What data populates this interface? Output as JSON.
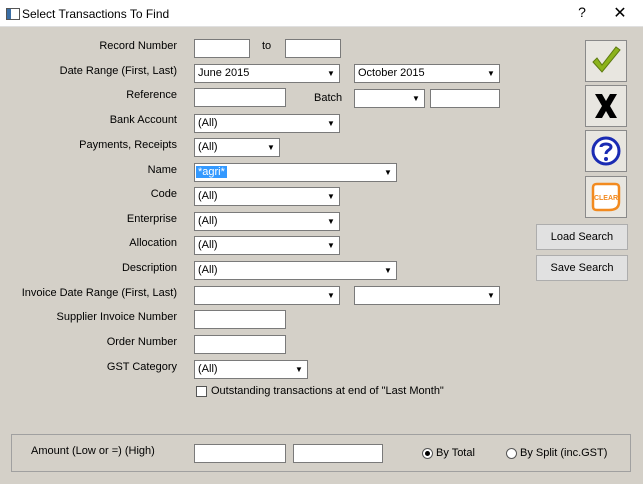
{
  "window": {
    "title": "Select Transactions To Find",
    "help": "?",
    "close": "✕"
  },
  "labels": {
    "record_number": "Record Number",
    "to": "to",
    "date_range": "Date Range (First, Last)",
    "reference": "Reference",
    "batch": "Batch",
    "bank_account": "Bank Account",
    "payments_receipts": "Payments, Receipts",
    "name": "Name",
    "code": "Code",
    "enterprise": "Enterprise",
    "allocation": "Allocation",
    "description": "Description",
    "invoice_date_range": "Invoice Date Range (First, Last)",
    "supplier_invoice_number": "Supplier Invoice Number",
    "order_number": "Order Number",
    "gst_category": "GST Category",
    "outstanding": "Outstanding transactions at end of \"Last Month\"",
    "amount": "Amount (Low or =) (High)",
    "by_total": "By Total",
    "by_split": "By Split (inc.GST)"
  },
  "values": {
    "date_first": "June 2015",
    "date_last": "October 2015",
    "bank_account": "(All)",
    "payments_receipts": "(All)",
    "name": "*agri*",
    "code": "(All)",
    "enterprise": "(All)",
    "allocation": "(All)",
    "description": "(All)",
    "gst_category": "(All)"
  },
  "buttons": {
    "ok_icon": "checkmark-icon",
    "cancel_icon": "x-icon",
    "help_icon": "question-icon",
    "clear_label": "CLEAR",
    "load_search": "Load Search",
    "save_search": "Save Search"
  },
  "colors": {
    "check_green": "#8cb31c",
    "help_blue": "#1a2bb3",
    "clear_orange": "#f28a1f"
  }
}
